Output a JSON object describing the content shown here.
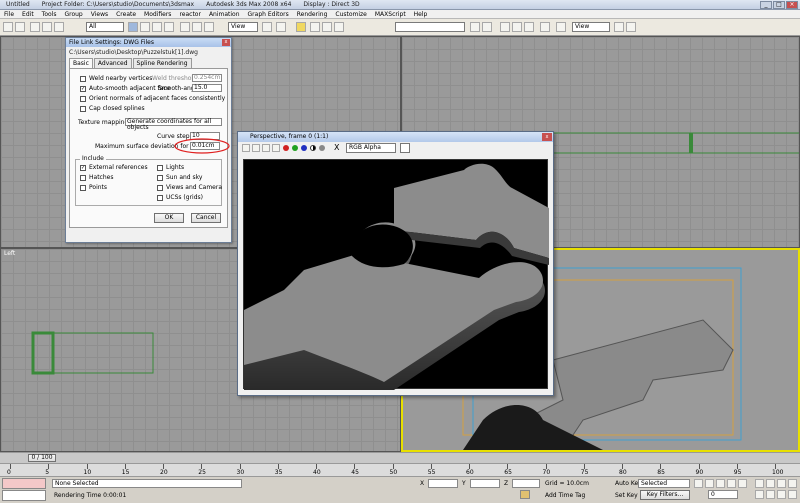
{
  "titlebar": {
    "file": "Untitled",
    "project": "Project Folder: C:\\Users\\studio\\Documents\\3dsmax",
    "app": "Autodesk 3ds Max 2008 x64",
    "display": "Display : Direct 3D"
  },
  "menu": [
    "File",
    "Edit",
    "Tools",
    "Group",
    "Views",
    "Create",
    "Modifiers",
    "reactor",
    "Animation",
    "Graph Editors",
    "Rendering",
    "Customize",
    "MAXScript",
    "Help"
  ],
  "toolbar": {
    "filter_value": "All",
    "refcoord_value": "View",
    "view_value": "View"
  },
  "viewports": {
    "left_label": "Left"
  },
  "dialog": {
    "title": "File Link Settings: DWG Files",
    "close": "x",
    "path": "C:\\Users\\studio\\Desktop\\Puzzelstuk[1].dwg",
    "tabs": [
      "Basic",
      "Advanced",
      "Spline Rendering"
    ],
    "weld_label": "Weld nearby vertices",
    "weld_threshold_label": "Weld threshold:",
    "weld_threshold_value": "0.254cm",
    "autosmooth_label": "Auto-smooth adjacent face",
    "smooth_angle_label": "Smooth-angle:",
    "smooth_angle_value": "15.0",
    "orient_label": "Orient normals of adjacent faces consistently",
    "cap_label": "Cap closed splines",
    "texture_label": "Texture mapping:",
    "texture_value": "Generate coordinates for all objects",
    "curve_steps_label": "Curve steps:",
    "curve_steps_value": "10",
    "max_dev_label": "Maximum surface deviation for 3D solids:",
    "max_dev_value": "0.01cm",
    "include_label": "Include",
    "include_left": [
      "External references",
      "Hatches",
      "Points"
    ],
    "include_right": [
      "Lights",
      "Sun and sky",
      "Views and Camera",
      "UCSs (grids)"
    ],
    "ok": "OK",
    "cancel": "Cancel"
  },
  "render": {
    "title": "Perspective, frame 0 (1:1)",
    "close": "x",
    "channel_value": "RGB Alpha",
    "channel_x": "X"
  },
  "timeline": {
    "slider": "0 / 100"
  },
  "ruler": [
    "0",
    "5",
    "10",
    "15",
    "20",
    "25",
    "30",
    "35",
    "40",
    "45",
    "50",
    "55",
    "60",
    "65",
    "70",
    "75",
    "80",
    "85",
    "90",
    "95",
    "100"
  ],
  "status": {
    "selection": "None Selected",
    "render_time": "Rendering Time  0:00:01",
    "x_label": "X",
    "y_label": "Y",
    "z_label": "Z",
    "grid": "Grid = 10.0cm",
    "add_time_tag": "Add Time Tag",
    "auto_key": "Auto Key",
    "selected_value": "Selected",
    "set_key": "Set Key",
    "key_filters": "Key Filters...",
    "frame_value": "0"
  }
}
